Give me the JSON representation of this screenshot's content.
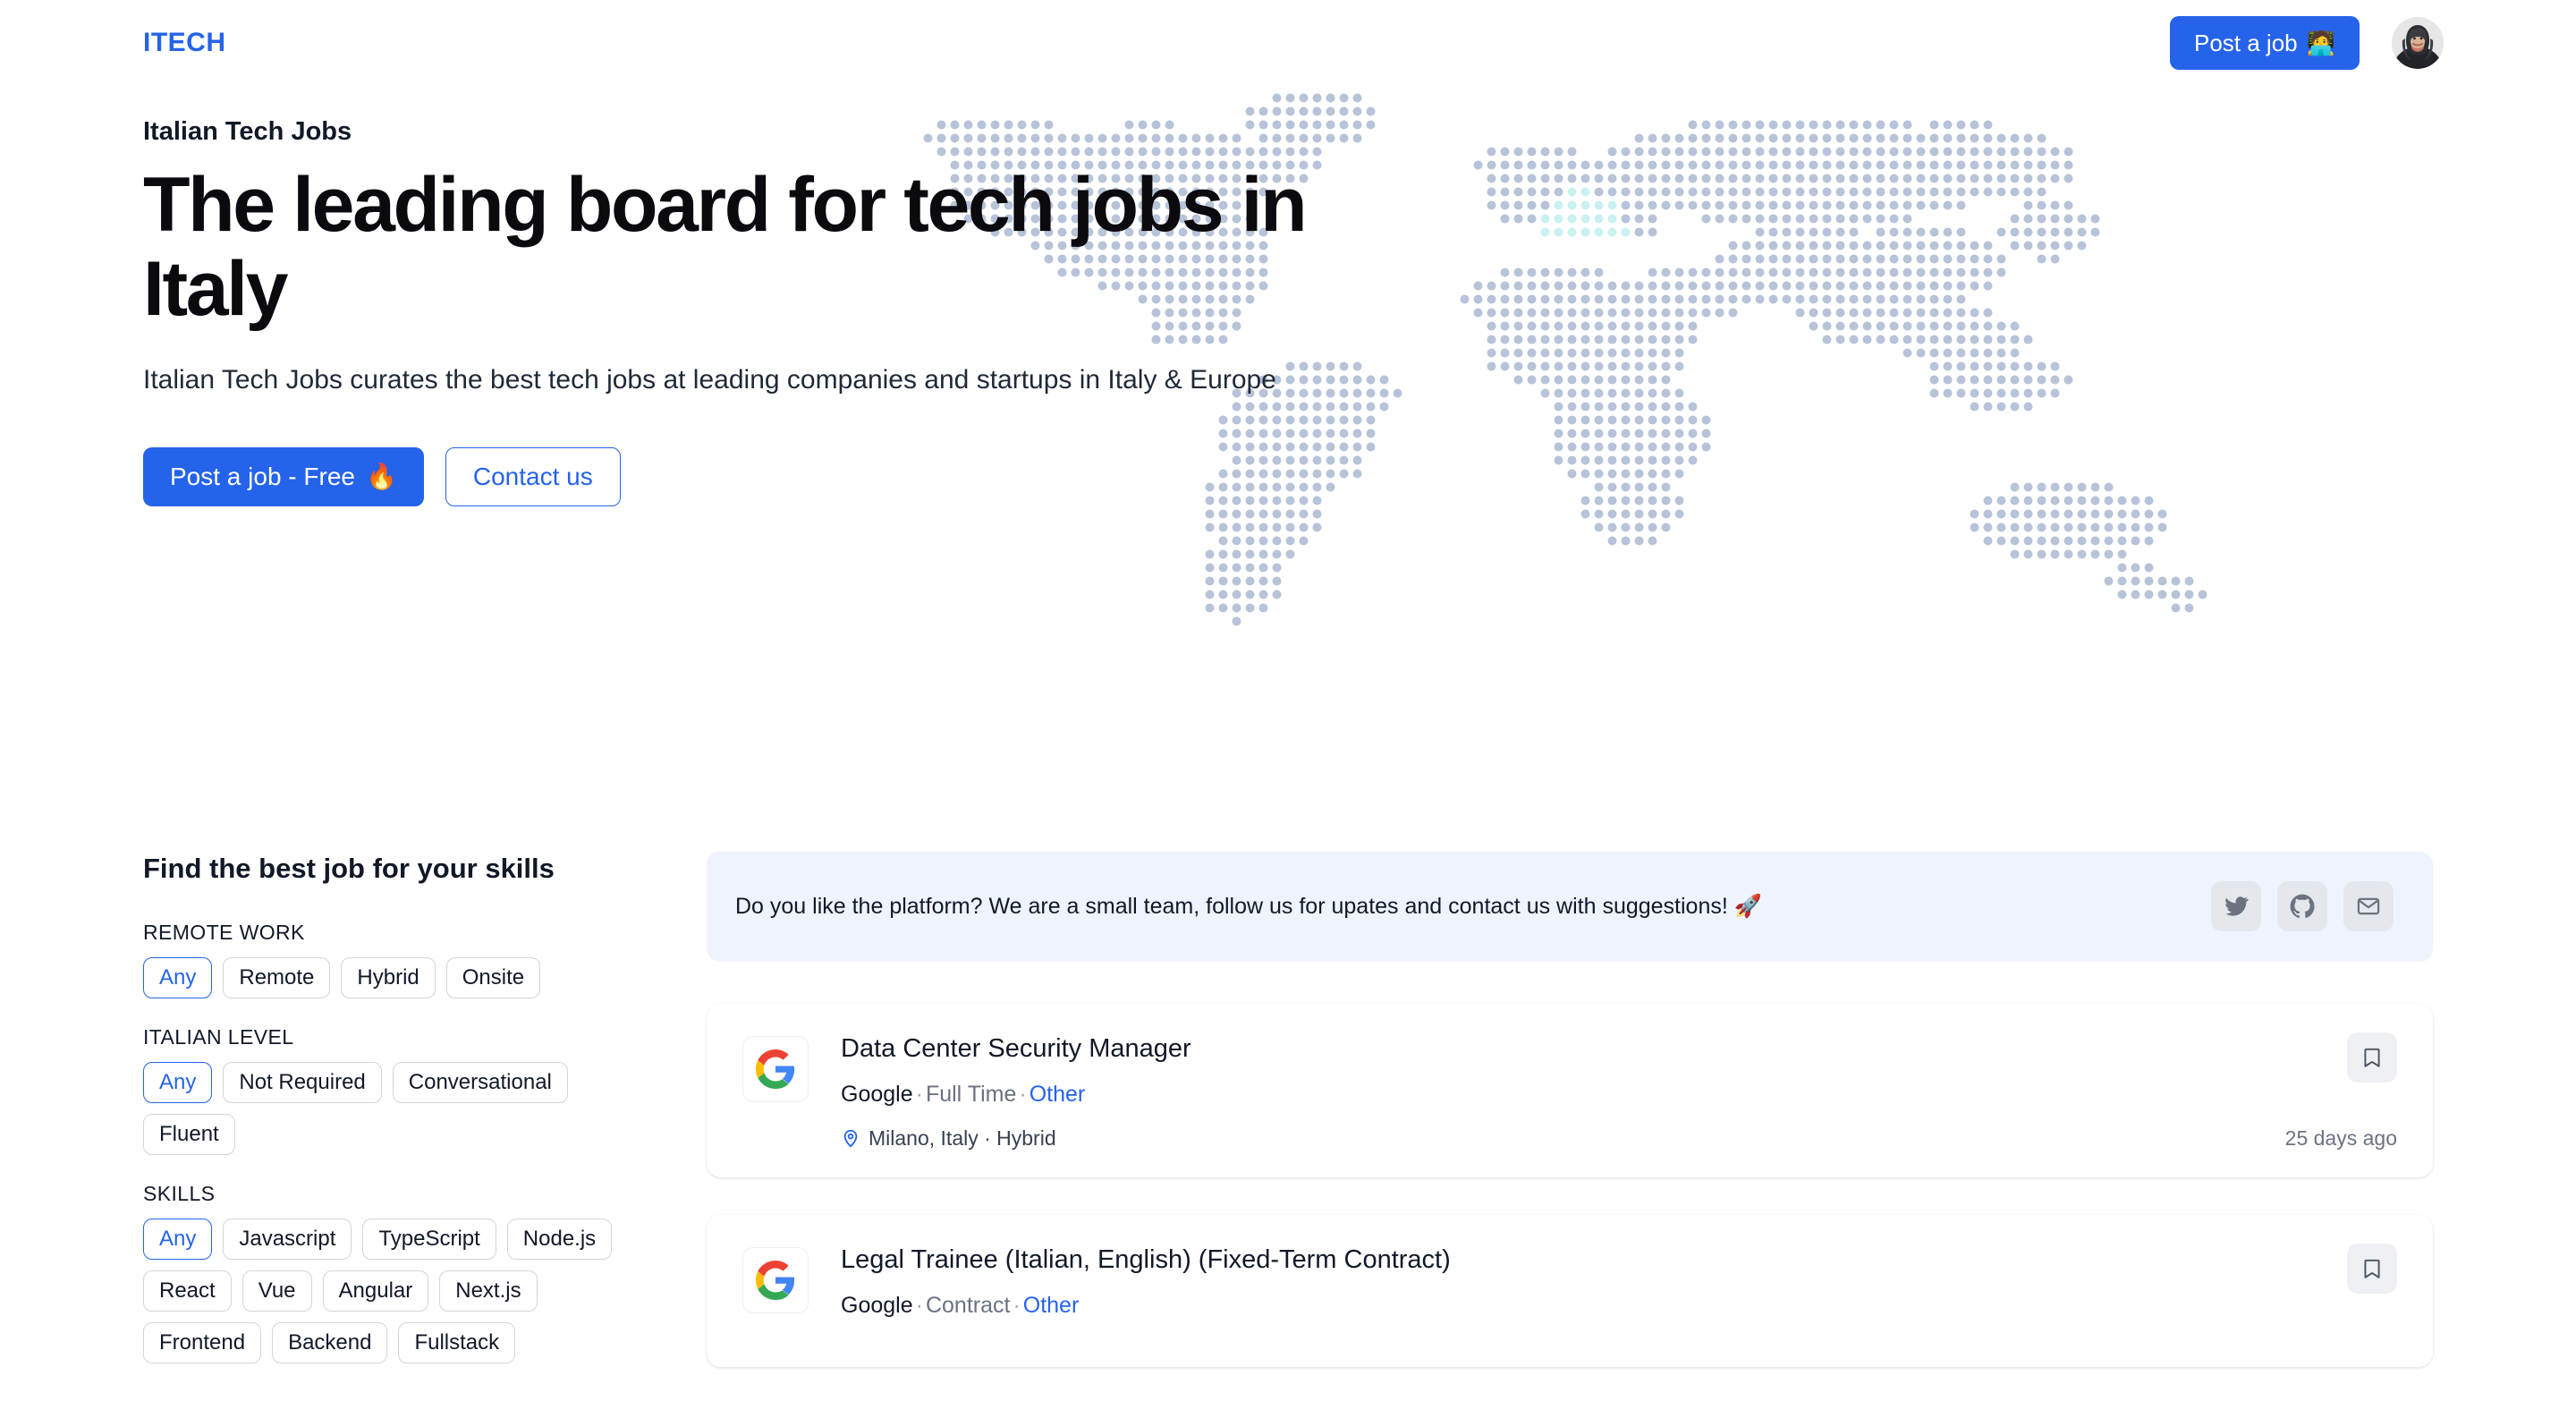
{
  "header": {
    "logo": "ITECH",
    "post_job_label": "Post a job",
    "post_job_emoji": "🧑‍💻"
  },
  "hero": {
    "eyebrow": "Italian Tech Jobs",
    "title": "The leading board for tech jobs in Italy",
    "subtitle": "Italian Tech Jobs curates the best tech jobs at leading companies and startups in Italy & Europe",
    "cta_primary": "Post a job - Free",
    "cta_primary_emoji": "🔥",
    "cta_secondary": "Contact us"
  },
  "filters": {
    "heading": "Find the best job for your skills",
    "groups": [
      {
        "label": "REMOTE WORK",
        "options": [
          "Any",
          "Remote",
          "Hybrid",
          "Onsite"
        ],
        "selected": "Any"
      },
      {
        "label": "ITALIAN LEVEL",
        "options": [
          "Any",
          "Not Required",
          "Conversational",
          "Fluent"
        ],
        "selected": "Any"
      },
      {
        "label": "SKILLS",
        "options": [
          "Any",
          "Javascript",
          "TypeScript",
          "Node.js",
          "React",
          "Vue",
          "Angular",
          "Next.js",
          "Frontend",
          "Backend",
          "Fullstack"
        ],
        "selected": "Any"
      }
    ]
  },
  "promo": {
    "text": "Do you like the platform? We are a small team, follow us for upates and contact us with suggestions! 🚀",
    "socials": [
      "twitter-icon",
      "github-icon",
      "email-icon"
    ]
  },
  "jobs": [
    {
      "title": "Data Center Security Manager",
      "company": "Google",
      "employment_type": "Full Time",
      "category": "Other",
      "location": "Milano, Italy · Hybrid",
      "age": "25 days ago",
      "logo": "google-logo"
    },
    {
      "title": "Legal Trainee (Italian, English) (Fixed-Term Contract)",
      "company": "Google",
      "employment_type": "Contract",
      "category": "Other",
      "location": "",
      "age": "",
      "logo": "google-logo"
    }
  ],
  "colors": {
    "accent": "#2563eb",
    "map_dot": "#b6c3d8",
    "map_highlight": "#c9f1f1",
    "promo_bg": "#eef3fe",
    "chip_border": "#d1d5db"
  }
}
